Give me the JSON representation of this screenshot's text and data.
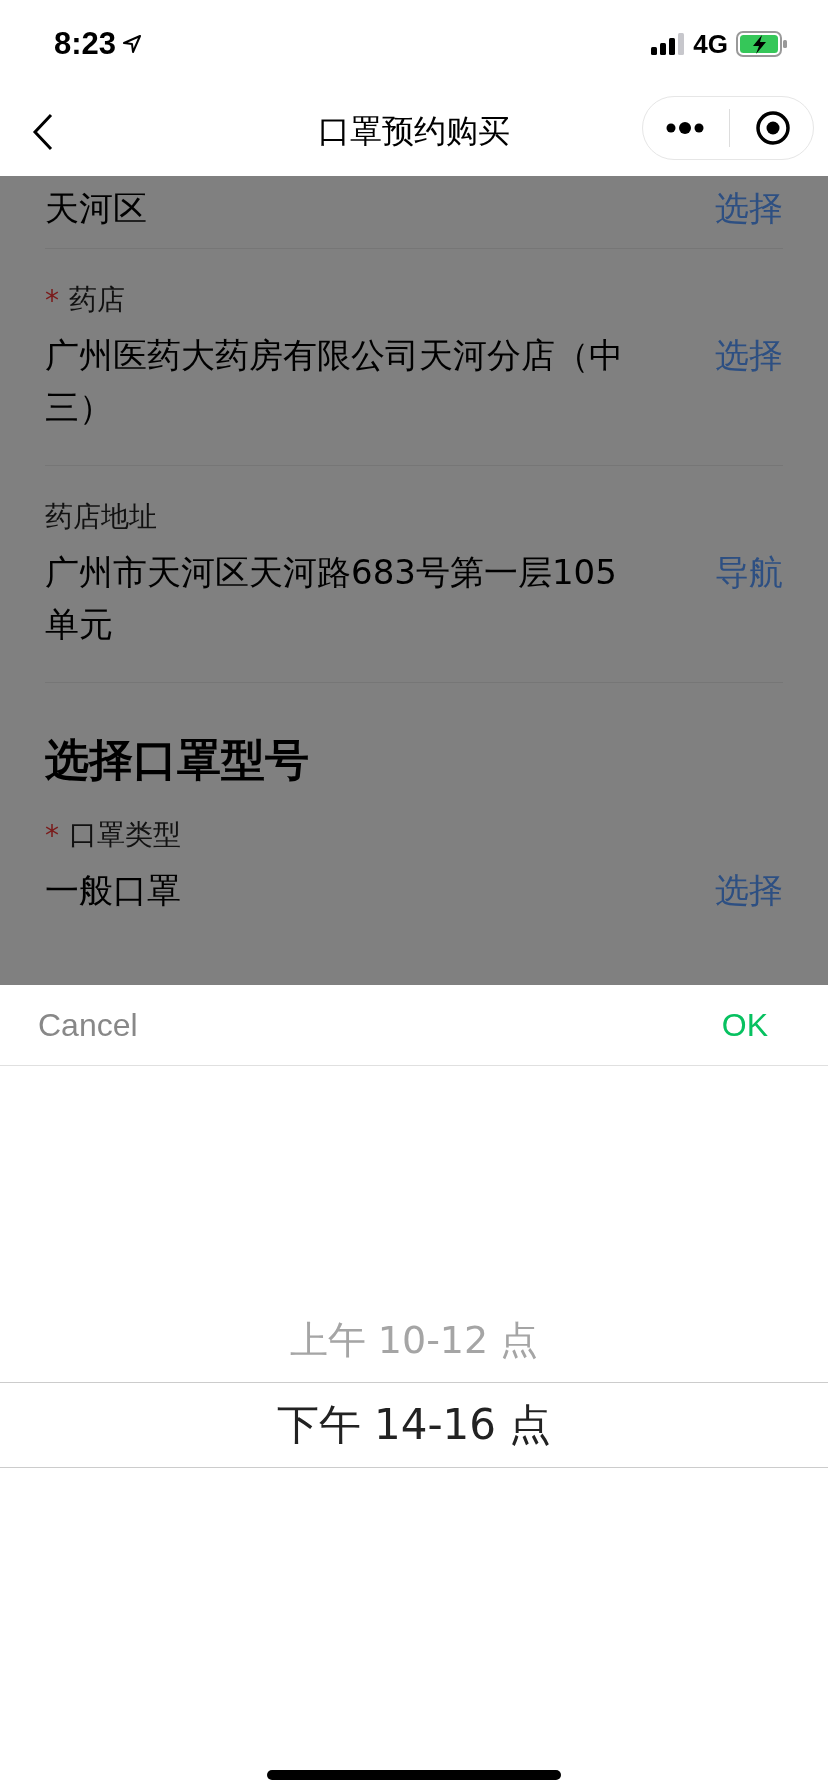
{
  "status_bar": {
    "time": "8:23",
    "network": "4G"
  },
  "nav": {
    "title": "口罩预约购买"
  },
  "content": [
    {
      "kind": "field",
      "value": "天河区",
      "action": "选择"
    },
    {
      "kind": "field",
      "label": "药店",
      "required_mark": "*",
      "value": "广州医药大药房有限公司天河分店（中三）",
      "action": "选择"
    },
    {
      "kind": "field",
      "label": "药店地址",
      "value": "广州市天河区天河路683号第一层105单元",
      "action": "导航"
    },
    {
      "kind": "heading",
      "text": "选择口罩型号"
    },
    {
      "kind": "field",
      "label": "口罩类型",
      "required_mark": "*",
      "value": "一般口罩",
      "action": "选择"
    }
  ],
  "picker": {
    "cancel": "Cancel",
    "ok": "OK",
    "options": [
      {
        "label": "上午 10-12 点",
        "selected": false
      },
      {
        "label": "下午 14-16 点",
        "selected": true
      }
    ]
  }
}
